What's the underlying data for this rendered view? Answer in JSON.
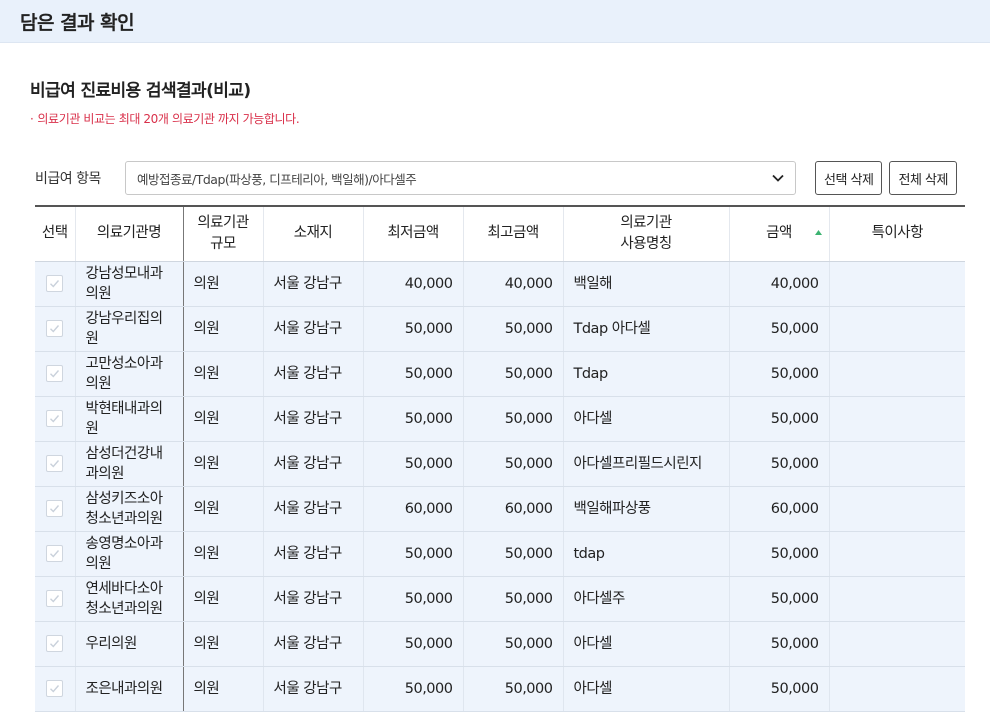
{
  "page": {
    "title": "담은 결과 확인"
  },
  "section": {
    "title": "비급여 진료비용 검색결과(비교)",
    "notice_bullet": "·",
    "notice": "의료기관 비교는 최대 20개 의료기관 까지 가능합니다."
  },
  "filter": {
    "label": "비급여 항목",
    "selected": "예방접종료/Tdap(파상풍, 디프테리아, 백일해)/아다셀주",
    "delete_selected_label": "선택 삭제",
    "delete_all_label": "전체 삭제"
  },
  "table": {
    "headers": {
      "select": "선택",
      "name": "의료기관명",
      "size_l1": "의료기관",
      "size_l2": "규모",
      "location": "소재지",
      "min": "최저금액",
      "max": "최고금액",
      "usename_l1": "의료기관",
      "usename_l2": "사용명칭",
      "amount": "금액",
      "note": "특이사항"
    },
    "sort": {
      "column": "amount",
      "direction": "asc",
      "color": "#3cb371"
    },
    "rows": [
      {
        "name_l1": "강남성모내과",
        "name_l2": "의원",
        "size": "의원",
        "location": "서울 강남구",
        "min": "40,000",
        "max": "40,000",
        "use_name": "백일해",
        "amount": "40,000",
        "note": ""
      },
      {
        "name_l1": "강남우리집의",
        "name_l2": "원",
        "size": "의원",
        "location": "서울 강남구",
        "min": "50,000",
        "max": "50,000",
        "use_name": "Tdap 아다셀",
        "amount": "50,000",
        "note": ""
      },
      {
        "name_l1": "고만성소아과",
        "name_l2": "의원",
        "size": "의원",
        "location": "서울 강남구",
        "min": "50,000",
        "max": "50,000",
        "use_name": "Tdap",
        "amount": "50,000",
        "note": ""
      },
      {
        "name_l1": "박현태내과의",
        "name_l2": "원",
        "size": "의원",
        "location": "서울 강남구",
        "min": "50,000",
        "max": "50,000",
        "use_name": "아다셀",
        "amount": "50,000",
        "note": ""
      },
      {
        "name_l1": "삼성더건강내",
        "name_l2": "과의원",
        "size": "의원",
        "location": "서울 강남구",
        "min": "50,000",
        "max": "50,000",
        "use_name": "아다셀프리필드시린지",
        "amount": "50,000",
        "note": ""
      },
      {
        "name_l1": "삼성키즈소아",
        "name_l2": "청소년과의원",
        "size": "의원",
        "location": "서울 강남구",
        "min": "60,000",
        "max": "60,000",
        "use_name": "백일해파상풍",
        "amount": "60,000",
        "note": ""
      },
      {
        "name_l1": "송영명소아과",
        "name_l2": "의원",
        "size": "의원",
        "location": "서울 강남구",
        "min": "50,000",
        "max": "50,000",
        "use_name": "tdap",
        "amount": "50,000",
        "note": ""
      },
      {
        "name_l1": "연세바다소아",
        "name_l2": "청소년과의원",
        "size": "의원",
        "location": "서울 강남구",
        "min": "50,000",
        "max": "50,000",
        "use_name": "아다셀주",
        "amount": "50,000",
        "note": ""
      },
      {
        "name_l1": "우리의원",
        "name_l2": "",
        "size": "의원",
        "location": "서울 강남구",
        "min": "50,000",
        "max": "50,000",
        "use_name": "아다셀",
        "amount": "50,000",
        "note": ""
      },
      {
        "name_l1": "조은내과의원",
        "name_l2": "",
        "size": "의원",
        "location": "서울 강남구",
        "min": "50,000",
        "max": "50,000",
        "use_name": "아다셀",
        "amount": "50,000",
        "note": ""
      }
    ]
  }
}
